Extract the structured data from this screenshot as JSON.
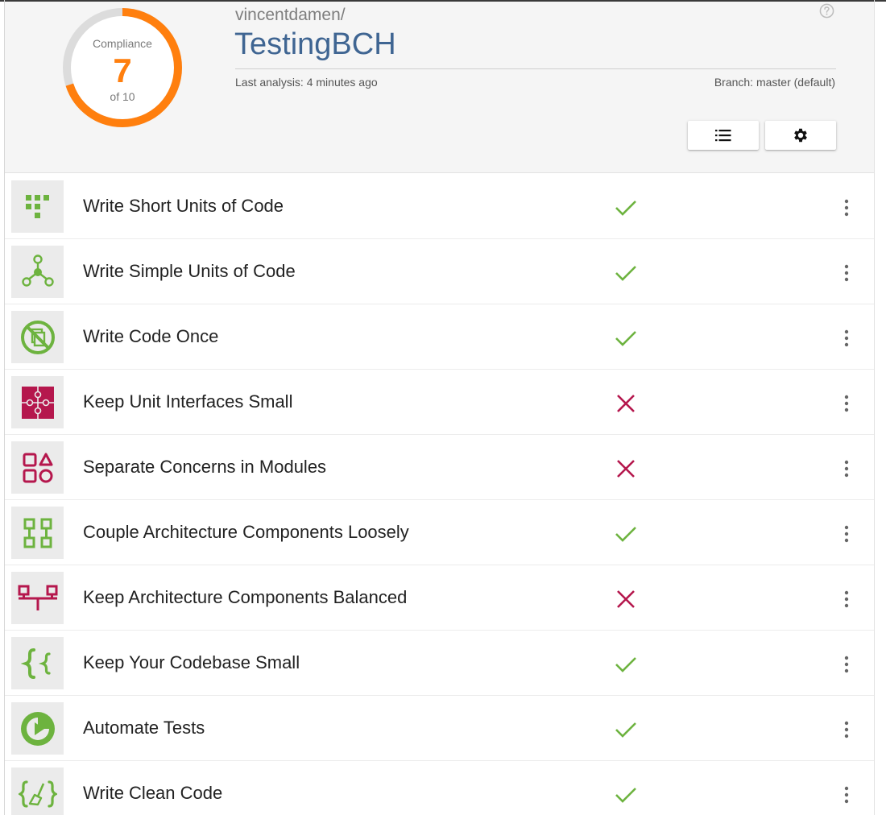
{
  "colors": {
    "accent_orange": "#ff7f0e",
    "pass_green": "#6db33f",
    "fail_red": "#b5174d",
    "repo_blue": "#3f6592"
  },
  "compliance": {
    "label": "Compliance",
    "value": "7",
    "of_text": "of 10",
    "score": 7,
    "max": 10
  },
  "header": {
    "owner": "vincentdamen/",
    "repo": "TestingBCH",
    "last_analysis": "Last analysis: 4 minutes ago",
    "branch": "Branch: master (default)",
    "help_icon": "help-circle-icon",
    "list_button_icon": "list-icon",
    "settings_button_icon": "gear-icon"
  },
  "guidelines": [
    {
      "label": "Write Short Units of Code",
      "icon": "short-units-icon",
      "status": "pass"
    },
    {
      "label": "Write Simple Units of Code",
      "icon": "simple-units-icon",
      "status": "pass"
    },
    {
      "label": "Write Code Once",
      "icon": "no-duplication-icon",
      "status": "pass"
    },
    {
      "label": "Keep Unit Interfaces Small",
      "icon": "puzzle-icon",
      "status": "fail"
    },
    {
      "label": "Separate Concerns in Modules",
      "icon": "modules-icon",
      "status": "fail"
    },
    {
      "label": "Couple Architecture Components Loosely",
      "icon": "components-icon",
      "status": "pass"
    },
    {
      "label": "Keep Architecture Components Balanced",
      "icon": "balance-icon",
      "status": "fail"
    },
    {
      "label": "Keep Your Codebase Small",
      "icon": "braces-icon",
      "status": "pass"
    },
    {
      "label": "Automate Tests",
      "icon": "play-circle-icon",
      "status": "pass"
    },
    {
      "label": "Write Clean Code",
      "icon": "broom-braces-icon",
      "status": "pass"
    }
  ]
}
